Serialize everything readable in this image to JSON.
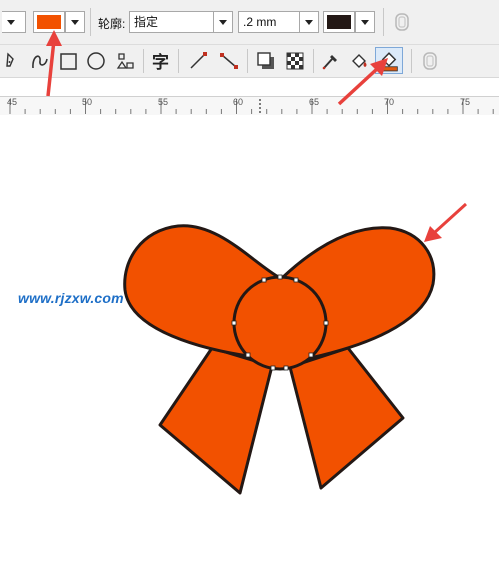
{
  "property_bar": {
    "fill_color": "#f25100",
    "outline_label": "轮廓:",
    "outline_style": "指定",
    "outline_width": ".2 mm",
    "outline_color": "#231815"
  },
  "toolbar": {
    "tools": [
      "pen-tool-icon",
      "curve-tool-icon",
      "rectangle-tool-icon",
      "ellipse-tool-icon",
      "polygon-tool-icon",
      "text-tool-icon",
      "line-tool-icon",
      "connector-tool-icon",
      "drop-shadow-tool-icon",
      "transparency-tool-icon",
      "eyedropper-tool-icon",
      "smart-fill-tool-icon",
      "interactive-fill-tool-icon"
    ]
  },
  "ruler": {
    "labels": [
      "45",
      "50",
      "55",
      "60",
      "65",
      "70",
      "75"
    ]
  },
  "canvas": {
    "watermark": "www.rjzxw.com",
    "bow_fill": "#f25100",
    "bow_outline": "#231815",
    "arrow_color": "#e8413c"
  }
}
